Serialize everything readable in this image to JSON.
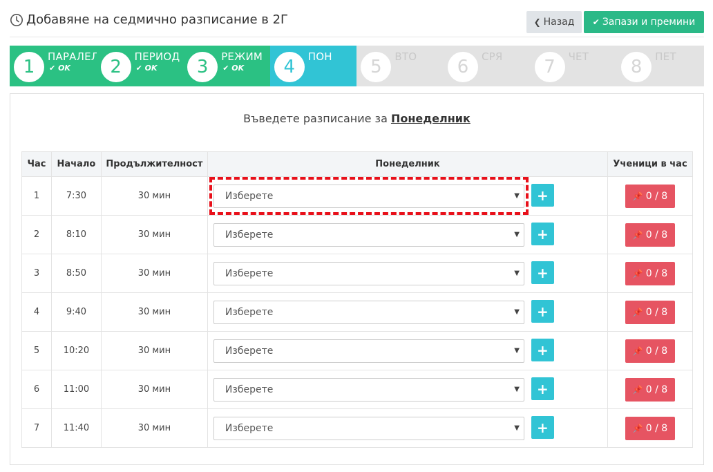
{
  "header": {
    "title": "Добавяне на седмично разписание в 2Г",
    "back_label": "Назад",
    "save_label": "Запази и премини"
  },
  "steps": [
    {
      "num": "1",
      "name": "ПАРАЛЕЛ",
      "status": "OK",
      "state": "done"
    },
    {
      "num": "2",
      "name": "ПЕРИОД",
      "status": "OK",
      "state": "done"
    },
    {
      "num": "3",
      "name": "РЕЖИМ",
      "status": "OK",
      "state": "done"
    },
    {
      "num": "4",
      "name": "ПОН",
      "status": "",
      "state": "active"
    },
    {
      "num": "5",
      "name": "ВТО",
      "status": "",
      "state": "pending"
    },
    {
      "num": "6",
      "name": "СРЯ",
      "status": "",
      "state": "pending"
    },
    {
      "num": "7",
      "name": "ЧЕТ",
      "status": "",
      "state": "pending"
    },
    {
      "num": "8",
      "name": "ПЕТ",
      "status": "",
      "state": "pending"
    }
  ],
  "prompt": {
    "text": "Въведете разписание за ",
    "day": "Понеделник"
  },
  "table": {
    "headers": [
      "Час",
      "Начало",
      "Продължителност",
      "Понеделник",
      "Ученици в час"
    ],
    "select_placeholder": "Изберете",
    "rows": [
      {
        "hour": "1",
        "start": "7:30",
        "duration": "30 мин",
        "subject": "Изберете",
        "students": "0 / 8"
      },
      {
        "hour": "2",
        "start": "8:10",
        "duration": "30 мин",
        "subject": "Изберете",
        "students": "0 / 8"
      },
      {
        "hour": "3",
        "start": "8:50",
        "duration": "30 мин",
        "subject": "Изберете",
        "students": "0 / 8"
      },
      {
        "hour": "4",
        "start": "9:40",
        "duration": "30 мин",
        "subject": "Изберете",
        "students": "0 / 8"
      },
      {
        "hour": "5",
        "start": "10:20",
        "duration": "30 мин",
        "subject": "Изберете",
        "students": "0 / 8"
      },
      {
        "hour": "6",
        "start": "11:00",
        "duration": "30 мин",
        "subject": "Изберете",
        "students": "0 / 8"
      },
      {
        "hour": "7",
        "start": "11:40",
        "duration": "30 мин",
        "subject": "Изберете",
        "students": "0 / 8"
      }
    ]
  },
  "colors": {
    "done": "#2bc183",
    "active": "#31c4d5",
    "pending": "#e3e3e3",
    "save": "#2bb987",
    "students_badge": "#e65462",
    "highlight": "#e8101a"
  },
  "icons": {
    "title": "clock-icon",
    "back": "chevron-left-icon",
    "save": "check-icon",
    "ok": "check-icon",
    "add": "plus-icon",
    "students": "pin-icon",
    "select": "caret-down-icon"
  }
}
